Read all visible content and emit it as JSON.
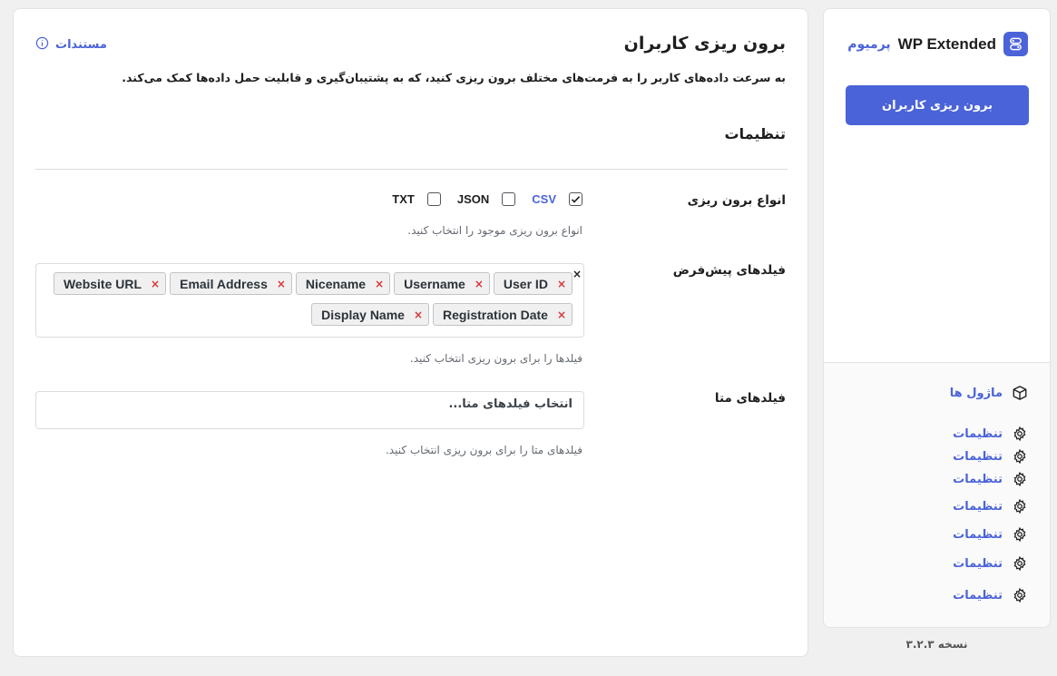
{
  "sidebar": {
    "brand_name": "WP Extended",
    "brand_badge": "پرمیوم",
    "active_button": "برون ریزی کاربران",
    "modules_label": "ماژول ها",
    "settings_items": [
      {
        "label": "تنظیمات"
      },
      {
        "label": "تنظیمات"
      },
      {
        "label": "تنظیمات"
      },
      {
        "label": "تنظیمات"
      },
      {
        "label": "تنظیمات"
      },
      {
        "label": "تنظیمات"
      },
      {
        "label": "تنظیمات"
      }
    ],
    "version": "نسخه ۳.۲.۳"
  },
  "main": {
    "title": "برون ریزی کاربران",
    "docs_label": "مستندات",
    "description": "به سرعت داده‌های کاربر را به فرمت‌های مختلف برون ریزی کنید، که به پشتیبان‌گیری و قابلیت حمل داده‌ها کمک می‌کند.",
    "section_title": "تنظیمات",
    "export_types": {
      "label": "انواع برون ریزی",
      "help": "انواع برون ریزی موجود را انتخاب کنید.",
      "options": [
        {
          "label": "CSV",
          "checked": true
        },
        {
          "label": "JSON",
          "checked": false
        },
        {
          "label": "TXT",
          "checked": false
        }
      ]
    },
    "default_fields": {
      "label": "فیلدهای پیش‌فرض",
      "help": "فیلدها را برای برون ریزی انتخاب کنید.",
      "clear": "×",
      "remove": "×",
      "tags": [
        "User ID",
        "Username",
        "Nicename",
        "Email Address",
        "Website URL",
        "Registration Date",
        "Display Name"
      ]
    },
    "meta_fields": {
      "label": "فیلدهای متا",
      "placeholder": "انتخاب فیلدهای متا...",
      "help": "فیلدهای متا را برای برون ریزی انتخاب کنید."
    }
  },
  "colors": {
    "accent": "#4b63d8",
    "tag_remove": "#d63638"
  }
}
